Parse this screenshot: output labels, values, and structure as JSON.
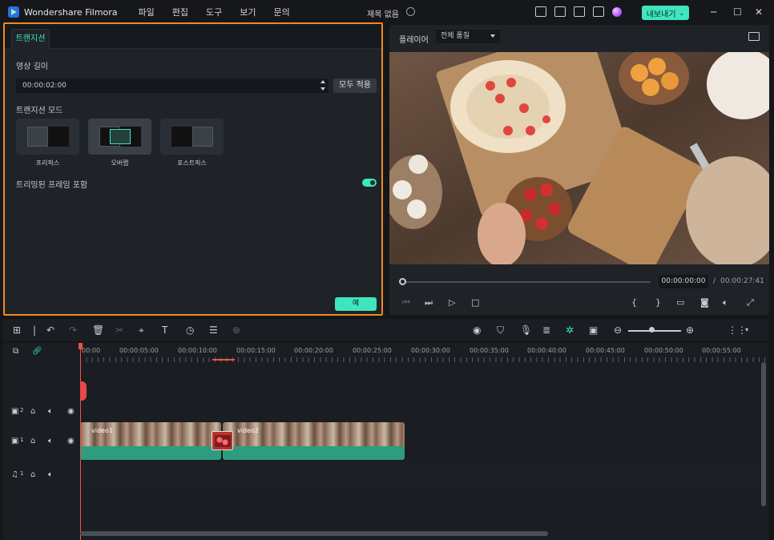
{
  "app": {
    "name": "Wondershare Filmora",
    "menu": [
      "파일",
      "편집",
      "도구",
      "보기",
      "문의"
    ],
    "doc_title": "제목 없음",
    "export_label": "내보내기"
  },
  "transition_panel": {
    "tab_label": "트랜지션",
    "duration_label": "영상 길이",
    "duration_value": "00:00:02:00",
    "apply_all_label": "모두 적용",
    "mode_label": "트랜지션 모드",
    "modes": [
      {
        "label": "프리픽스",
        "selected": false
      },
      {
        "label": "오버랩",
        "selected": true
      },
      {
        "label": "포스트픽스",
        "selected": false
      }
    ],
    "include_trimmed_label": "트리밍된 프레임 포함",
    "include_trimmed_on": true,
    "ok_label": "예",
    "highlight_color": "#f08a24"
  },
  "player": {
    "title": "플레이어",
    "quality": "전체 품질",
    "current_time": "00:00:00:00",
    "separator": "/",
    "total_time": "00:00:27:41",
    "progress": 0.0
  },
  "timeline": {
    "ruler_labels": [
      "00:00",
      "00:00:05:00",
      "00:00:10:00",
      "00:00:15:00",
      "00:00:20:00",
      "00:00:25:00",
      "00:00:30:00",
      "00:00:35:00",
      "00:00:40:00",
      "00:00:45:00",
      "00:00:50:00",
      "00:00:55:00"
    ],
    "tracks": [
      {
        "type": "video",
        "number": "2"
      },
      {
        "type": "video",
        "number": "1"
      },
      {
        "type": "audio",
        "number": "1"
      }
    ],
    "clips": [
      {
        "name": "video1"
      },
      {
        "name": "video2"
      }
    ]
  },
  "colors": {
    "accent": "#3fe6bd",
    "playhead": "#f0524a",
    "clip": "#2e9c7f"
  }
}
